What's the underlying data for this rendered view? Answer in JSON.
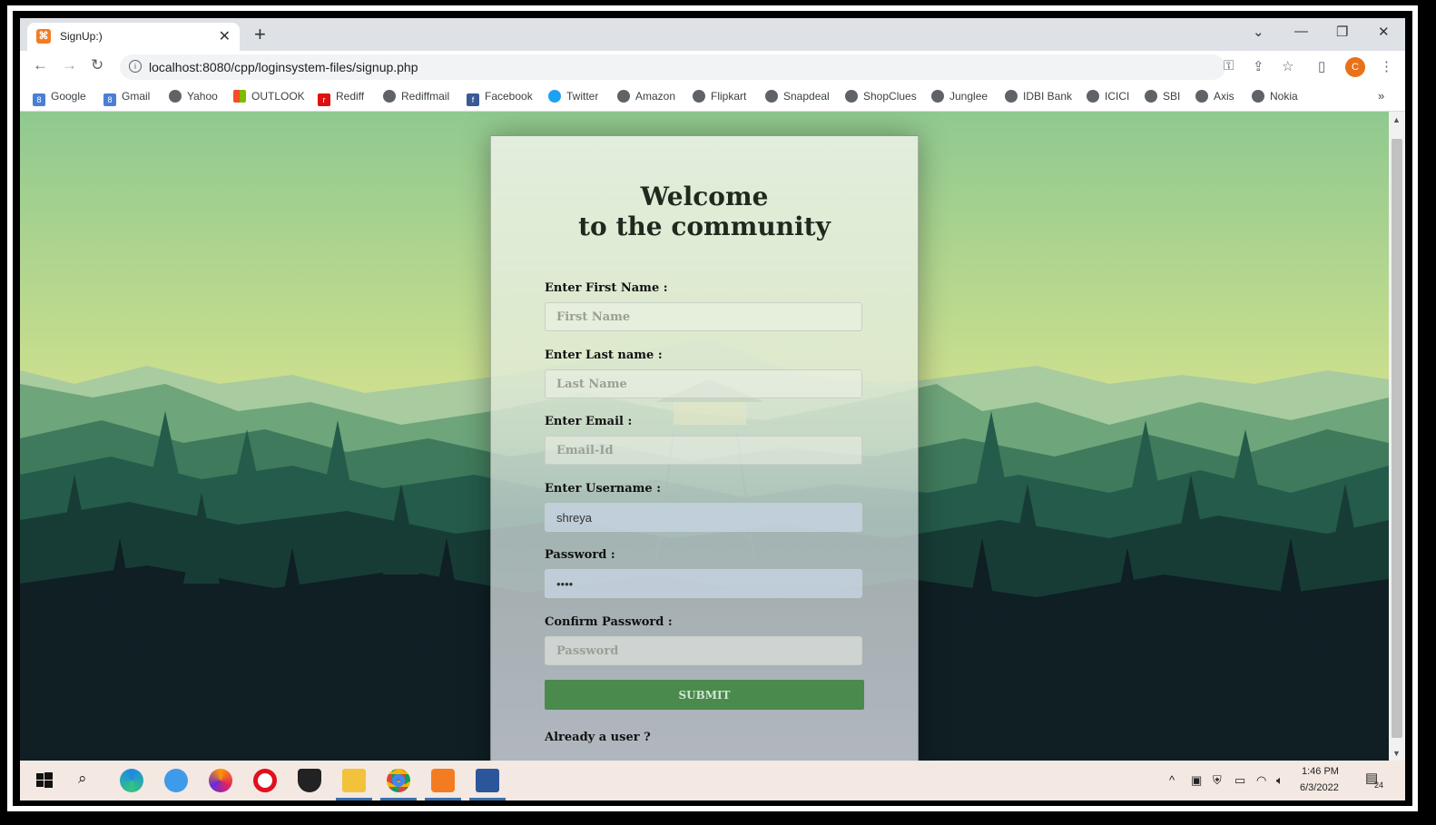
{
  "browser": {
    "tab_title": "SignUp:)",
    "tab_favicon": "xampp-icon",
    "url": "localhost:8080/cpp/loginsystem-files/signup.php",
    "profile_initial": "C",
    "bookmarks": [
      "Google",
      "Gmail",
      "Yahoo",
      "OUTLOOK",
      "Rediff",
      "Rediffmail",
      "Facebook",
      "Twitter",
      "Amazon",
      "Flipkart",
      "Snapdeal",
      "ShopClues",
      "Junglee",
      "IDBI Bank",
      "ICICI",
      "SBI",
      "Axis",
      "Nokia"
    ],
    "bookmarks_more": "»"
  },
  "form": {
    "title_line1": "Welcome",
    "title_line2": "to the community",
    "first_name": {
      "label": "Enter First Name :",
      "placeholder": "First Name",
      "value": ""
    },
    "last_name": {
      "label": "Enter Last name :",
      "placeholder": "Last Name",
      "value": ""
    },
    "email": {
      "label": "Enter Email :",
      "placeholder": "Email-Id",
      "value": ""
    },
    "username": {
      "label": "Enter Username :",
      "placeholder": "",
      "value": "shreya"
    },
    "password": {
      "label": "Password :",
      "placeholder": "",
      "value": "••••"
    },
    "confirm_password": {
      "label": "Confirm Password :",
      "placeholder": "Password",
      "value": ""
    },
    "submit_label": "SUBMIT",
    "already_user": "Already a user ?"
  },
  "taskbar": {
    "time": "1:46 PM",
    "date": "6/3/2022",
    "notification_count": "24",
    "apps": [
      "windows-start",
      "search",
      "edge",
      "internet-explorer",
      "firefox",
      "opera",
      "security",
      "file-explorer",
      "chrome",
      "xampp",
      "word"
    ]
  },
  "colors": {
    "submit": "#4b8a4d",
    "sky_top": "#8fc98f",
    "sky_bottom": "#e0e88c",
    "forest_dark": "#0f1f24"
  }
}
